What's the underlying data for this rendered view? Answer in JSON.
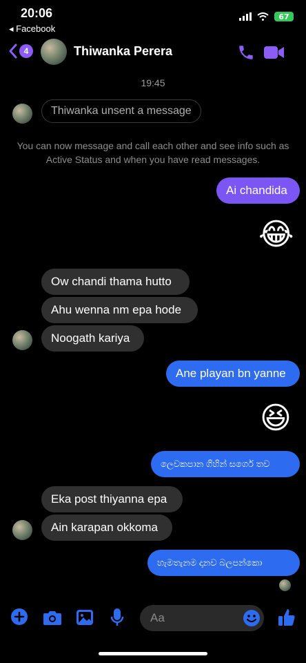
{
  "status": {
    "time": "20:06",
    "back_app": "◂ Facebook",
    "battery": "67"
  },
  "header": {
    "back_badge": "4",
    "contact_name": "Thiwanka Perera"
  },
  "conversation": {
    "timestamp": "19:45",
    "unsent_notice": "Thiwanka unsent a message",
    "info_text": "You can now message and call each other and see info such as Active Status and when you have read messages.",
    "messages": {
      "m1": "Ai chandida",
      "m2": "😂",
      "m3": "Ow chandi thama hutto",
      "m4": "Ahu wenna nm epa hode",
      "m5": "Noogath kariya",
      "m6": "Ane playan bn yanne",
      "m7": "😆",
      "m8": "ලෙවකපාන ගිහින් සර්ගෙ තව",
      "m9": "Eka post thiyanna epa",
      "m10": "Ain karapan okkoma",
      "m11": "හැමතැනම දානව බලපන්කො"
    }
  },
  "composer": {
    "placeholder": "Aa"
  },
  "colors": {
    "accent": "#8b5cf6",
    "sent_purple": "#7c56f5",
    "sent_blue": "#2d6bf0",
    "received": "#303030"
  }
}
